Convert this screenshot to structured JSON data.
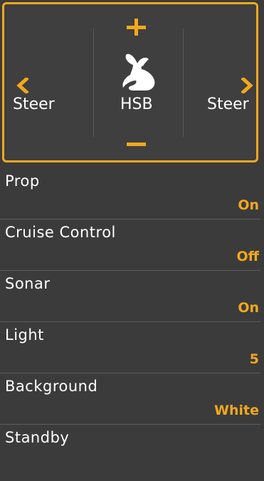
{
  "controls": {
    "plus_symbol": "+",
    "minus_symbol": "—",
    "left_arrow": "<",
    "right_arrow": ">",
    "left_label": "Steer",
    "center_label": "HSB",
    "right_label": "Steer",
    "center_icon": "rabbit-icon",
    "accent_color": "#f2a81d"
  },
  "menu": {
    "items": [
      {
        "label": "Prop",
        "value": "On"
      },
      {
        "label": "Cruise Control",
        "value": "Off"
      },
      {
        "label": "Sonar",
        "value": "On"
      },
      {
        "label": "Light",
        "value": "5"
      },
      {
        "label": "Background",
        "value": "White"
      },
      {
        "label": "Standby",
        "value": ""
      }
    ]
  }
}
